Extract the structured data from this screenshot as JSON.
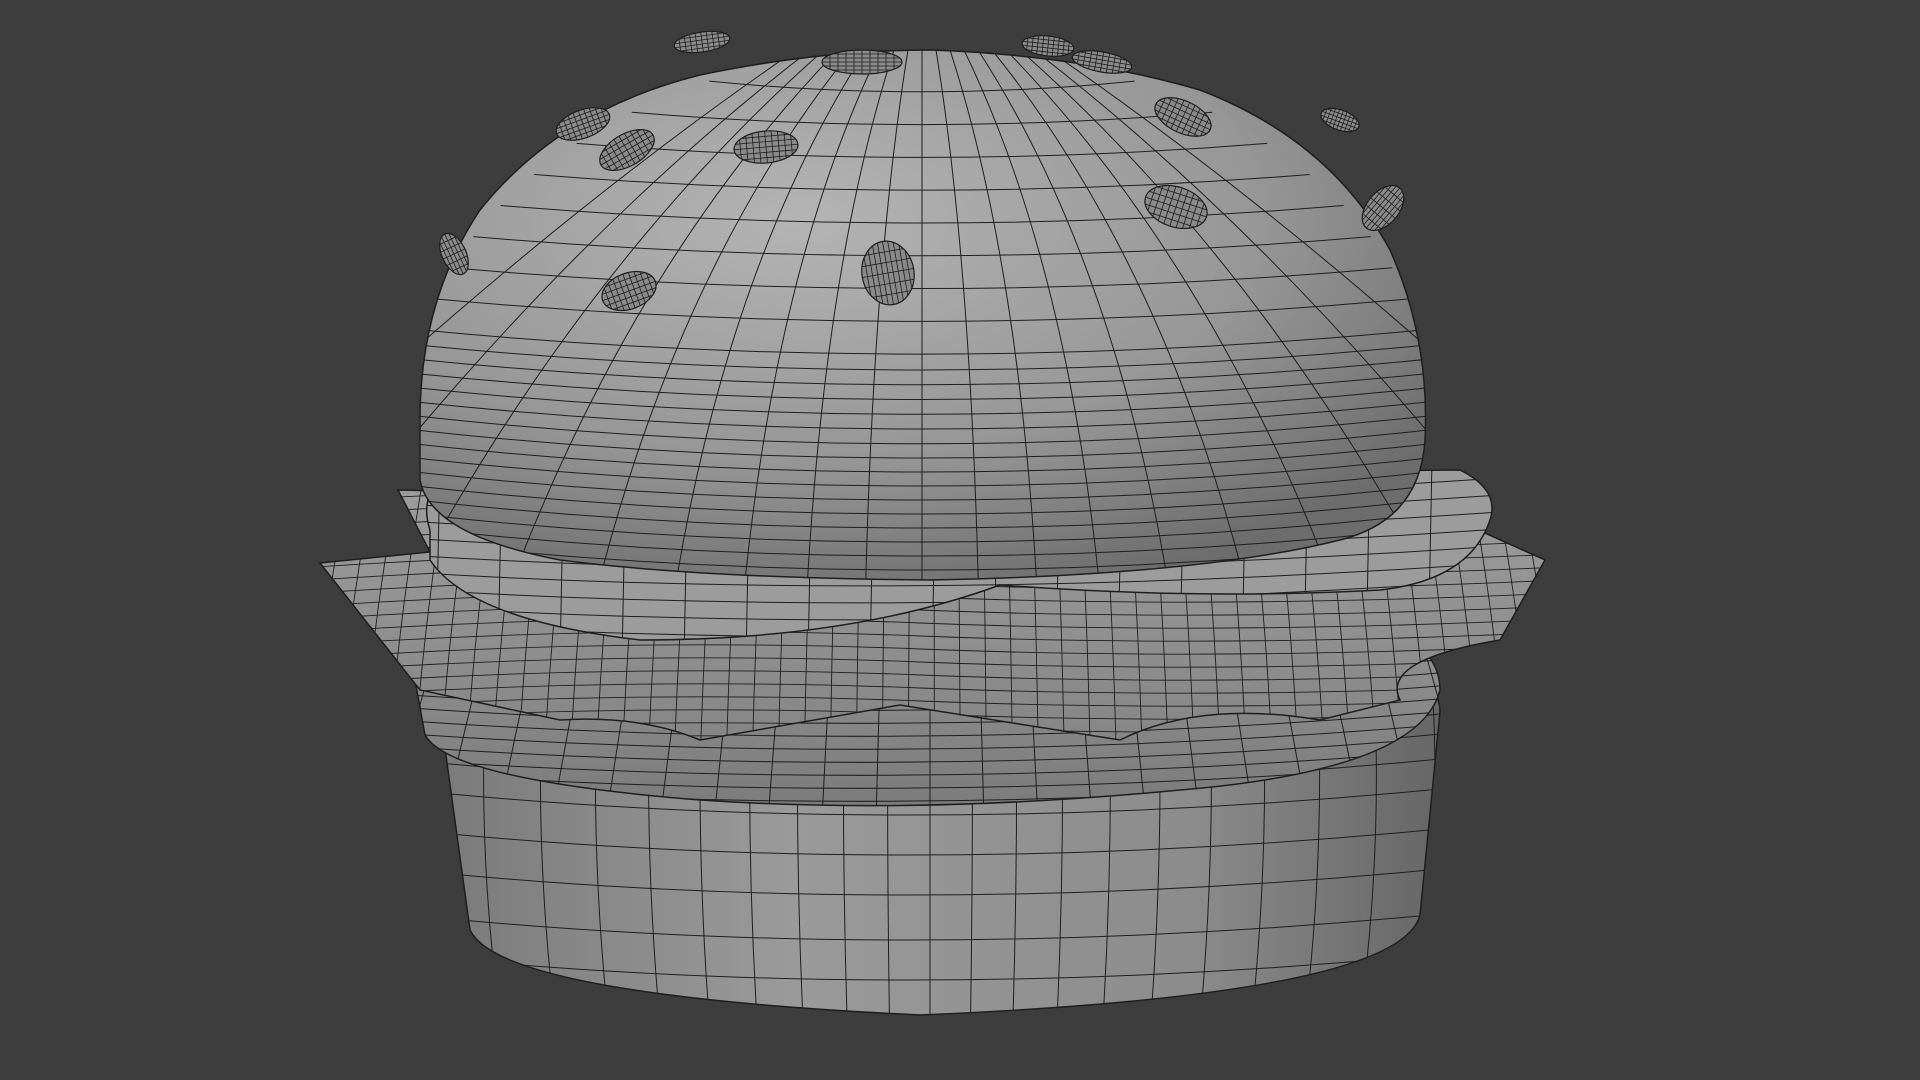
{
  "viewport": {
    "mode": "3d-viewport-solid-wireframe-overlay",
    "background_color": "#3d3d3d",
    "object": "burger-model",
    "parts": [
      "top-bun",
      "sesame-seeds",
      "cheese-slice",
      "lettuce-leaf",
      "patty",
      "bottom-bun"
    ],
    "mesh_color": "#8f8f8f",
    "wire_color": "#1e1e1e"
  }
}
